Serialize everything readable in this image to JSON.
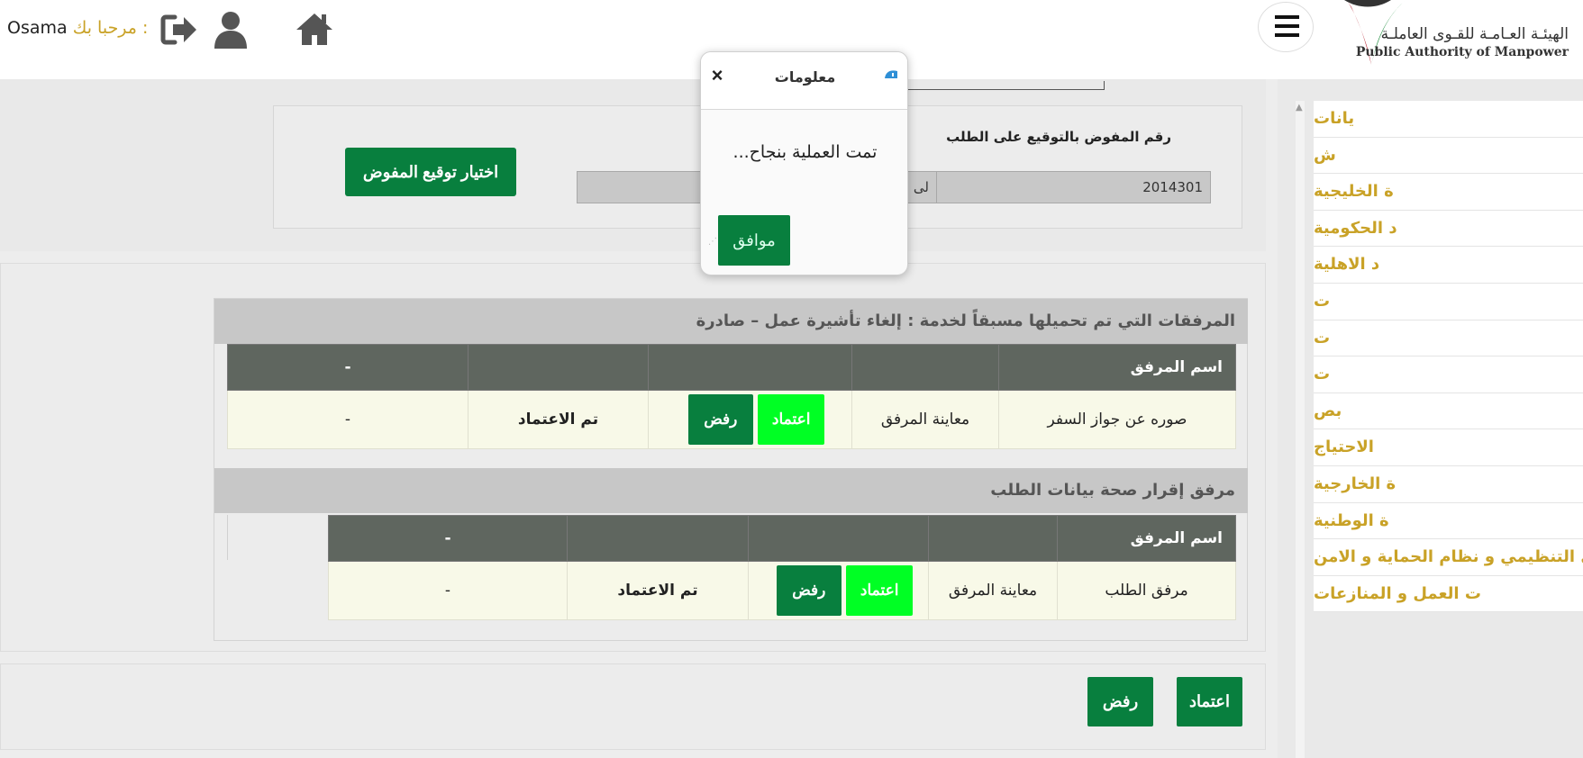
{
  "header": {
    "greeting_label": "مرحبا بك :",
    "user_name": "Osama",
    "logo_ar": "الهيئـة العـامـة للقـوى العاملـة",
    "logo_en": "Public Authority of Manpower"
  },
  "icons": {
    "logout": "logout-icon",
    "user": "user-icon",
    "home": "home-icon",
    "menu": "hamburger-menu-icon",
    "info": "info-icon"
  },
  "colors": {
    "gold": "#c9a227",
    "dark_green": "#087f3e",
    "bright_green": "#00ff24",
    "table_header": "#5f665f",
    "row_bg": "#f8f9e8"
  },
  "sidebar": {
    "items": [
      {
        "label": "يانات"
      },
      {
        "label": "ش"
      },
      {
        "label": "ة الخليجية"
      },
      {
        "label": "د الحكومية"
      },
      {
        "label": "د الاهلية"
      },
      {
        "label": "ت"
      },
      {
        "label": "ت"
      },
      {
        "label": "ت"
      },
      {
        "label": "بص"
      },
      {
        "label": " الاحتياج"
      },
      {
        "label": "ة الخارجية"
      },
      {
        "label": "ة الوطنية"
      },
      {
        "label": "ى التنظيمي و نظام الحماية و الامن"
      },
      {
        "label": "ت العمل و المنازعات"
      }
    ]
  },
  "signature": {
    "delegate_label": "رقم المفوض بالتوقيع على الطلب",
    "delegate_value": "2014301",
    "second_value": "لى",
    "choose_button": "اختيار توقيع المفوض"
  },
  "section1": {
    "title": "المرفقات التي تم تحميلها مسبقاً لخدمة : إلغاء تأشيرة عمل – صادرة",
    "headers": [
      "اسم المرفق",
      "",
      "",
      "",
      "-"
    ],
    "row": {
      "name": "صوره عن جواز السفر",
      "preview": "معاينة المرفق",
      "approve": "اعتماد",
      "reject": "رفض",
      "status": "تم الاعتماد",
      "extra": "-"
    }
  },
  "section2": {
    "title": "مرفق إقرار صحة بيانات الطلب",
    "headers": [
      "اسم المرفق",
      "",
      "",
      "",
      "-"
    ],
    "row": {
      "name": "مرفق الطلب",
      "preview": "معاينة المرفق",
      "approve": "اعتماد",
      "reject": "رفض",
      "status": "تم الاعتماد",
      "extra": "-"
    }
  },
  "footer_actions": {
    "approve": "اعتماد",
    "reject": "رفض"
  },
  "dialog": {
    "title": "معلومات",
    "close": "×",
    "message": "تمت العملية بنجاح...",
    "ok": "موافق"
  }
}
